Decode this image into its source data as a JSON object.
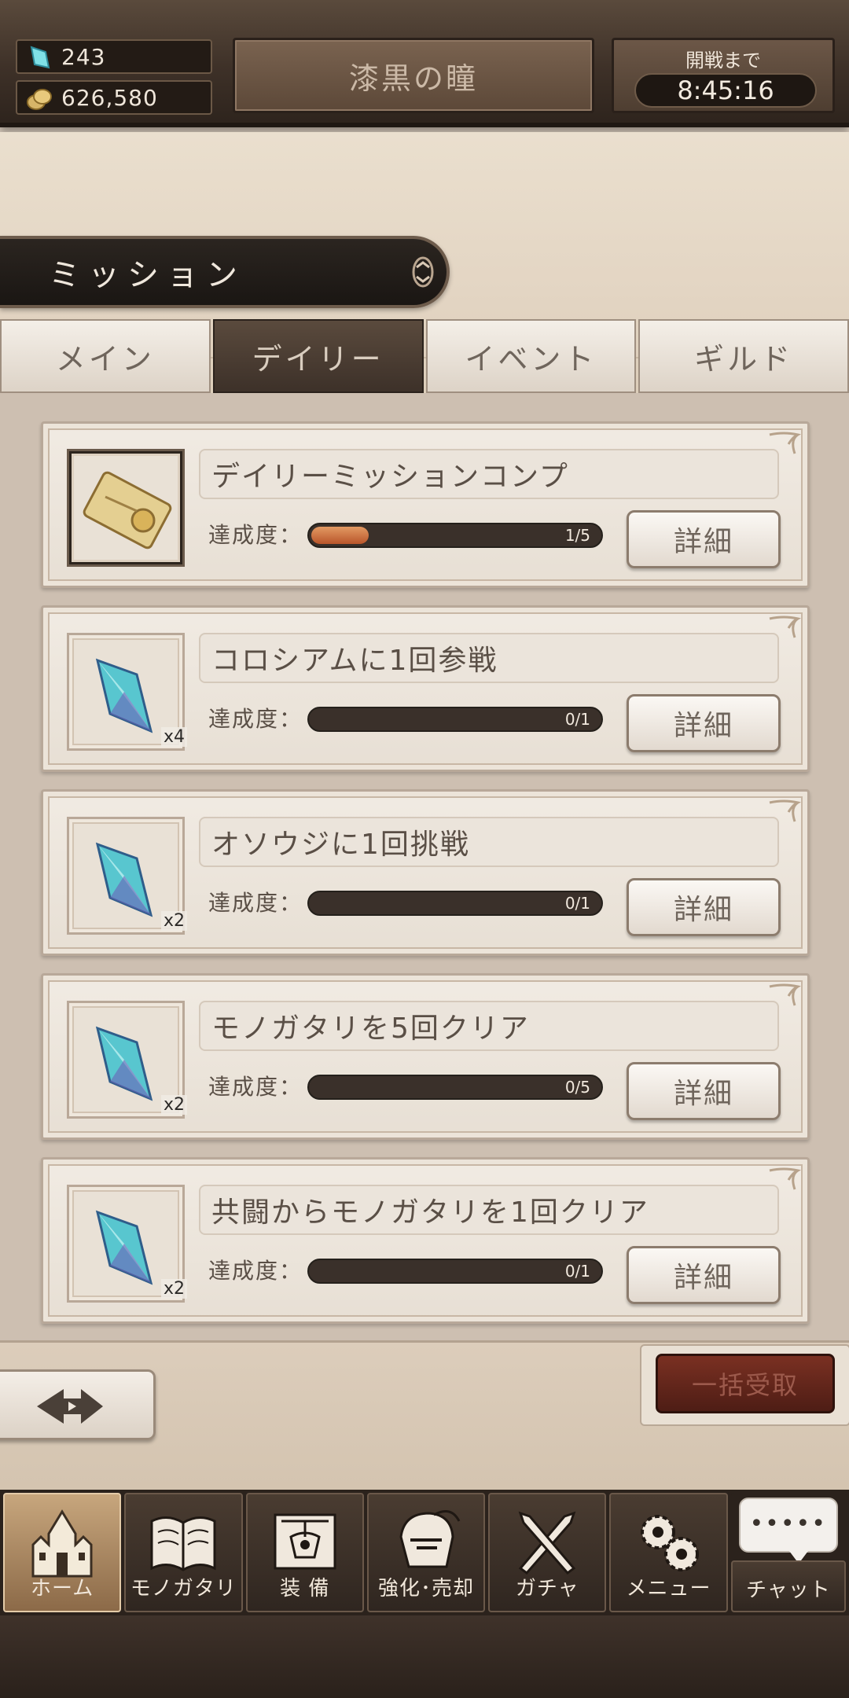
{
  "header": {
    "gems": "243",
    "coins": "626,580",
    "title": "漆黒の瞳",
    "timer_label": "開戦まで",
    "timer_value": "8:45:16"
  },
  "section": {
    "title": "ミッション"
  },
  "tabs": [
    {
      "label": "メイン",
      "active": false
    },
    {
      "label": "デイリー",
      "active": true
    },
    {
      "label": "イベント",
      "active": false
    },
    {
      "label": "ギルド",
      "active": false
    }
  ],
  "missions": [
    {
      "name": "デイリーミッションコンプ",
      "progress_label": "達成度：",
      "progress": "1/5",
      "progress_fraction": 0.2,
      "reward_icon": "ticket-icon",
      "quantity": "",
      "detail_label": "詳細"
    },
    {
      "name": "コロシアムに1回参戦",
      "progress_label": "達成度：",
      "progress": "0/1",
      "progress_fraction": 0,
      "reward_icon": "crystal-icon",
      "quantity": "x4",
      "detail_label": "詳細"
    },
    {
      "name": "オソウジに1回挑戦",
      "progress_label": "達成度：",
      "progress": "0/1",
      "progress_fraction": 0,
      "reward_icon": "crystal-icon",
      "quantity": "x2",
      "detail_label": "詳細"
    },
    {
      "name": "モノガタリを5回クリア",
      "progress_label": "達成度：",
      "progress": "0/5",
      "progress_fraction": 0,
      "reward_icon": "crystal-icon",
      "quantity": "x2",
      "detail_label": "詳細"
    },
    {
      "name": "共闘からモノガタリを1回クリア",
      "progress_label": "達成度：",
      "progress": "0/1",
      "progress_fraction": 0,
      "reward_icon": "crystal-icon",
      "quantity": "x2",
      "detail_label": "詳細"
    }
  ],
  "actions": {
    "collect_all": "一括受取"
  },
  "nav": [
    {
      "label": "ホーム",
      "icon": "castle-icon",
      "active": true
    },
    {
      "label": "モノガタリ",
      "icon": "book-icon",
      "active": false
    },
    {
      "label": "装 備",
      "icon": "equipment-icon",
      "active": false
    },
    {
      "label": "強化･売却",
      "icon": "helmet-icon",
      "active": false
    },
    {
      "label": "ガチャ",
      "icon": "swords-icon",
      "active": false
    },
    {
      "label": "メニュー",
      "icon": "gears-icon",
      "active": false
    },
    {
      "label": "チャット",
      "icon": "chat-icon",
      "active": false,
      "bubble": "•••••"
    }
  ],
  "colors": {
    "accent_dark": "#3d3129",
    "progress_fill": "#b9552a",
    "collect_button": "#5e2219"
  }
}
